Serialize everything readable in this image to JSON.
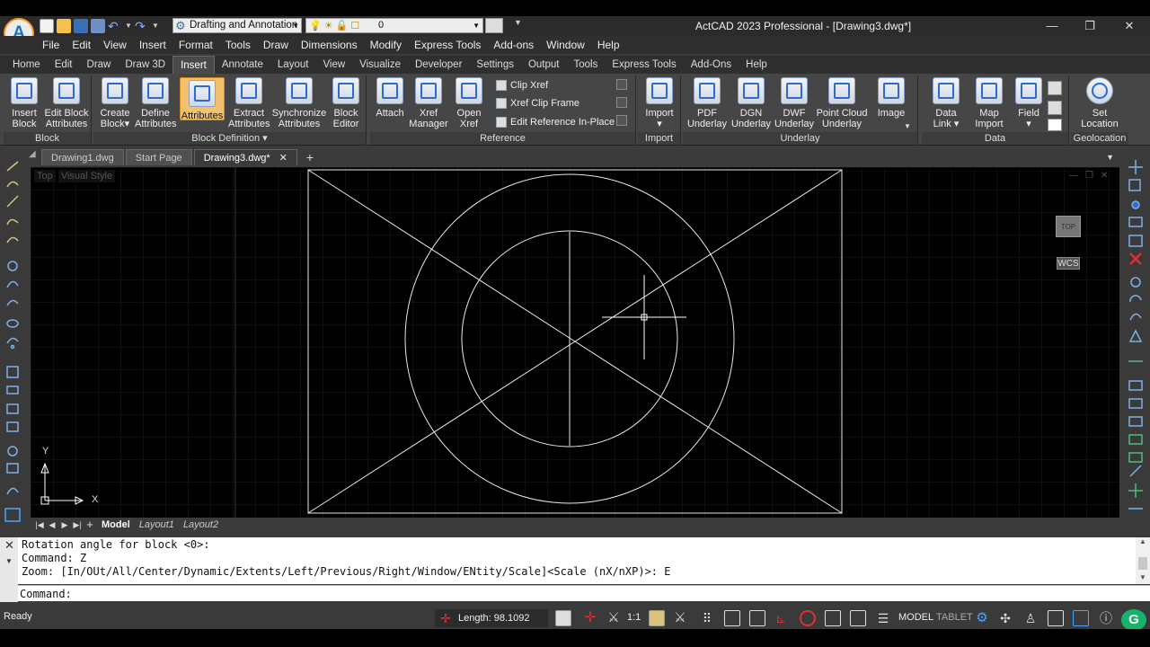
{
  "window": {
    "title": "ActCAD 2023 Professional - [Drawing3.dwg*]",
    "workspace": "Drafting and Annotation",
    "current_layer": "0",
    "minimize_icon": "minimize-icon",
    "restore_icon": "restore-icon",
    "close_icon": "close-icon"
  },
  "menubar": [
    "File",
    "Edit",
    "View",
    "Insert",
    "Format",
    "Tools",
    "Draw",
    "Dimensions",
    "Modify",
    "Express Tools",
    "Add-ons",
    "Window",
    "Help"
  ],
  "ribbon_tabs": [
    "Home",
    "Edit",
    "Draw",
    "Draw 3D",
    "Insert",
    "Annotate",
    "Layout",
    "View",
    "Visualize",
    "Developer",
    "Settings",
    "Output",
    "Tools",
    "Express Tools",
    "Add-Ons",
    "Help"
  ],
  "active_ribbon_tab": "Insert",
  "ribbon": {
    "block": {
      "label": "Block",
      "insert": "Insert\nBlock",
      "edit_attr": "Edit Block\nAttributes"
    },
    "block_def": {
      "label": "Block Definition ▾",
      "create": "Create\nBlock▾",
      "define": "Define\nAttributes",
      "attributes": "Attributes",
      "extract": "Extract\nAttributes",
      "sync": "Synchronize\nAttributes",
      "editor": "Block\nEditor"
    },
    "reference": {
      "label": "Reference",
      "attach": "Attach",
      "xref_mgr": "Xref\nManager",
      "open_xref": "Open\nXref",
      "clip_xref": "Clip Xref",
      "xref_clip_frame": "Xref Clip Frame",
      "edit_ref": "Edit Reference In-Place"
    },
    "import": {
      "label": "Import",
      "import": "Import\n▾"
    },
    "underlay": {
      "label": "Underlay",
      "pdf": "PDF\nUnderlay",
      "dgn": "DGN\nUnderlay",
      "dwf": "DWF\nUnderlay",
      "cloud": "Point Cloud\nUnderlay",
      "image": "Image"
    },
    "data": {
      "label": "Data",
      "data_link": "Data\nLink ▾",
      "map_import": "Map\nImport",
      "field": "Field\n▾"
    },
    "geolocation": {
      "label": "Geolocation",
      "set_location": "Set\nLocation"
    }
  },
  "doc_tabs": [
    "Drawing1.dwg",
    "Start Page",
    "Drawing3.dwg*"
  ],
  "active_doc": "Drawing3.dwg*",
  "viewport": {
    "view": "Top",
    "style": "Visual Style",
    "viewcube": "TOP",
    "ucs": "WCS",
    "axis_x": "X",
    "axis_y": "Y"
  },
  "layout_tabs": [
    "Model",
    "Layout1",
    "Layout2"
  ],
  "command": {
    "history": [
      "Rotation angle for block <0>:",
      "Command: Z",
      "Zoom:  [In/OUt/All/Center/Dynamic/Extents/Left/Previous/Right/Window/ENtity/Scale]<Scale (nX/nXP)>: E"
    ],
    "prompt": "Command:"
  },
  "status": {
    "ready": "Ready",
    "length": "Length: 98.1092",
    "scale": "1:1",
    "model": "MODEL",
    "tablet": "TABLET"
  },
  "colors": {
    "accent": "#f39c1f",
    "canvas": "#000000",
    "selected_tool": "#f3c06b",
    "grid": "#1e1e1e"
  }
}
